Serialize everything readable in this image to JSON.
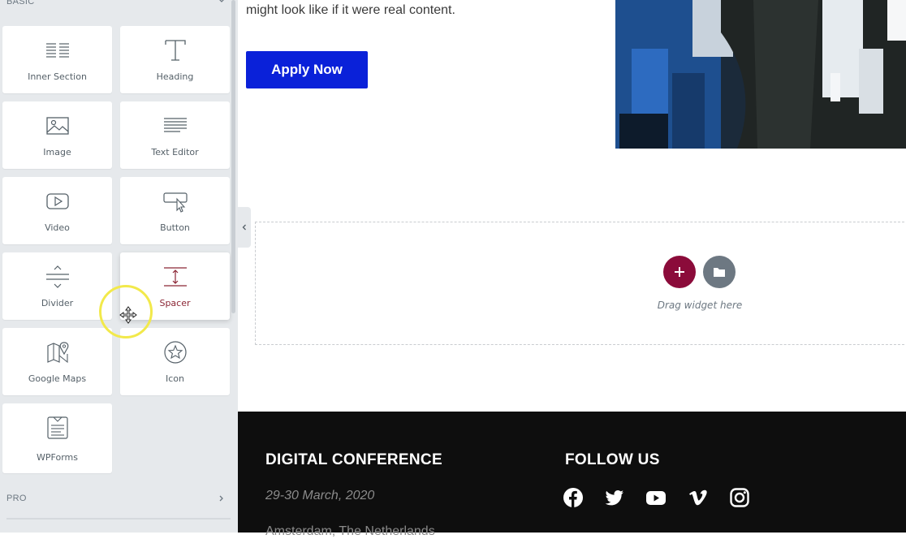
{
  "panel": {
    "basic_section_label": "BASIC",
    "pro_section_label": "PRO",
    "widgets": [
      {
        "label": "Inner Section",
        "icon": "inner-section-icon"
      },
      {
        "label": "Heading",
        "icon": "heading-icon"
      },
      {
        "label": "Image",
        "icon": "image-icon"
      },
      {
        "label": "Text Editor",
        "icon": "text-editor-icon"
      },
      {
        "label": "Video",
        "icon": "video-icon"
      },
      {
        "label": "Button",
        "icon": "button-icon"
      },
      {
        "label": "Divider",
        "icon": "divider-icon"
      },
      {
        "label": "Spacer",
        "icon": "spacer-icon"
      },
      {
        "label": "Google Maps",
        "icon": "google-maps-icon"
      },
      {
        "label": "Icon",
        "icon": "star-icon"
      },
      {
        "label": "WPForms",
        "icon": "wpforms-icon"
      }
    ]
  },
  "content": {
    "hero_text": "might look like if it were real content.",
    "apply_button": "Apply Now",
    "drop_zone_hint": "Drag widget here"
  },
  "footer": {
    "conference_title": "DIGITAL CONFERENCE",
    "date": "29-30 March, 2020",
    "location": "Amsterdam, The Netherlands",
    "follow_title": "FOLLOW US",
    "social": [
      "facebook-icon",
      "twitter-icon",
      "youtube-icon",
      "vimeo-icon",
      "instagram-icon"
    ]
  },
  "colors": {
    "accent_blue": "#0a21d9",
    "add_button": "#8b0b3a",
    "template_button": "#6d7882",
    "active_widget_label": "#8b2635",
    "footer_bg": "#0e0e0e"
  }
}
